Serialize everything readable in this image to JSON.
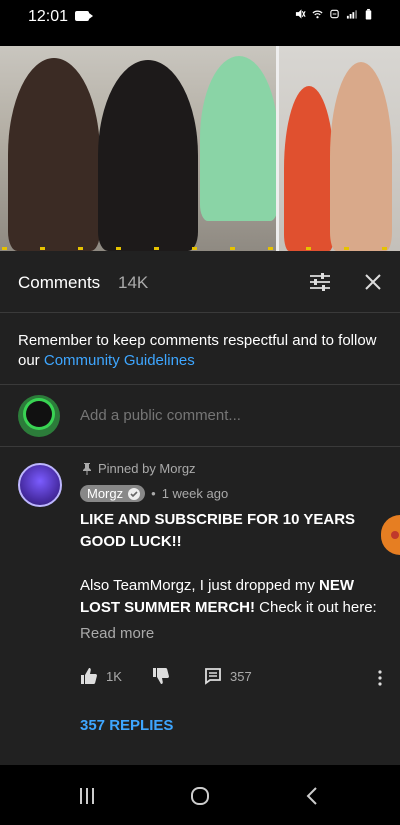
{
  "status_bar": {
    "time": "12:01",
    "icons": [
      "video-call-icon",
      "mute-icon",
      "wifi-icon",
      "data-icon",
      "signal-icon",
      "battery-icon"
    ]
  },
  "video": {
    "description_icon": "video-thumbnail"
  },
  "comments": {
    "title": "Comments",
    "count": "14K",
    "filter_icon": "sort-filter-icon",
    "close_icon": "close-icon"
  },
  "guidelines": {
    "text": "Remember to keep comments respectful and to follow our ",
    "link": "Community Guidelines"
  },
  "add_comment": {
    "placeholder": "Add a public comment..."
  },
  "comment": {
    "pinned_label": "Pinned by Morgz",
    "author": "Morgz",
    "time": "1 week ago",
    "line1": "LIKE AND SUBSCRIBE FOR 10 YEARS GOOD LUCK!!",
    "line2_prefix": "Also TeamMorgz, I just dropped my ",
    "line2_bold": "NEW LOST SUMMER MERCH!",
    "line2_suffix": " Check it out here:",
    "read_more": "Read more",
    "likes": "1K",
    "replies_count": "357",
    "replies_button": "357 REPLIES"
  },
  "colors": {
    "background": "#212121",
    "accent_link": "#3ea6ff",
    "muted_text": "#aaaaaa"
  }
}
